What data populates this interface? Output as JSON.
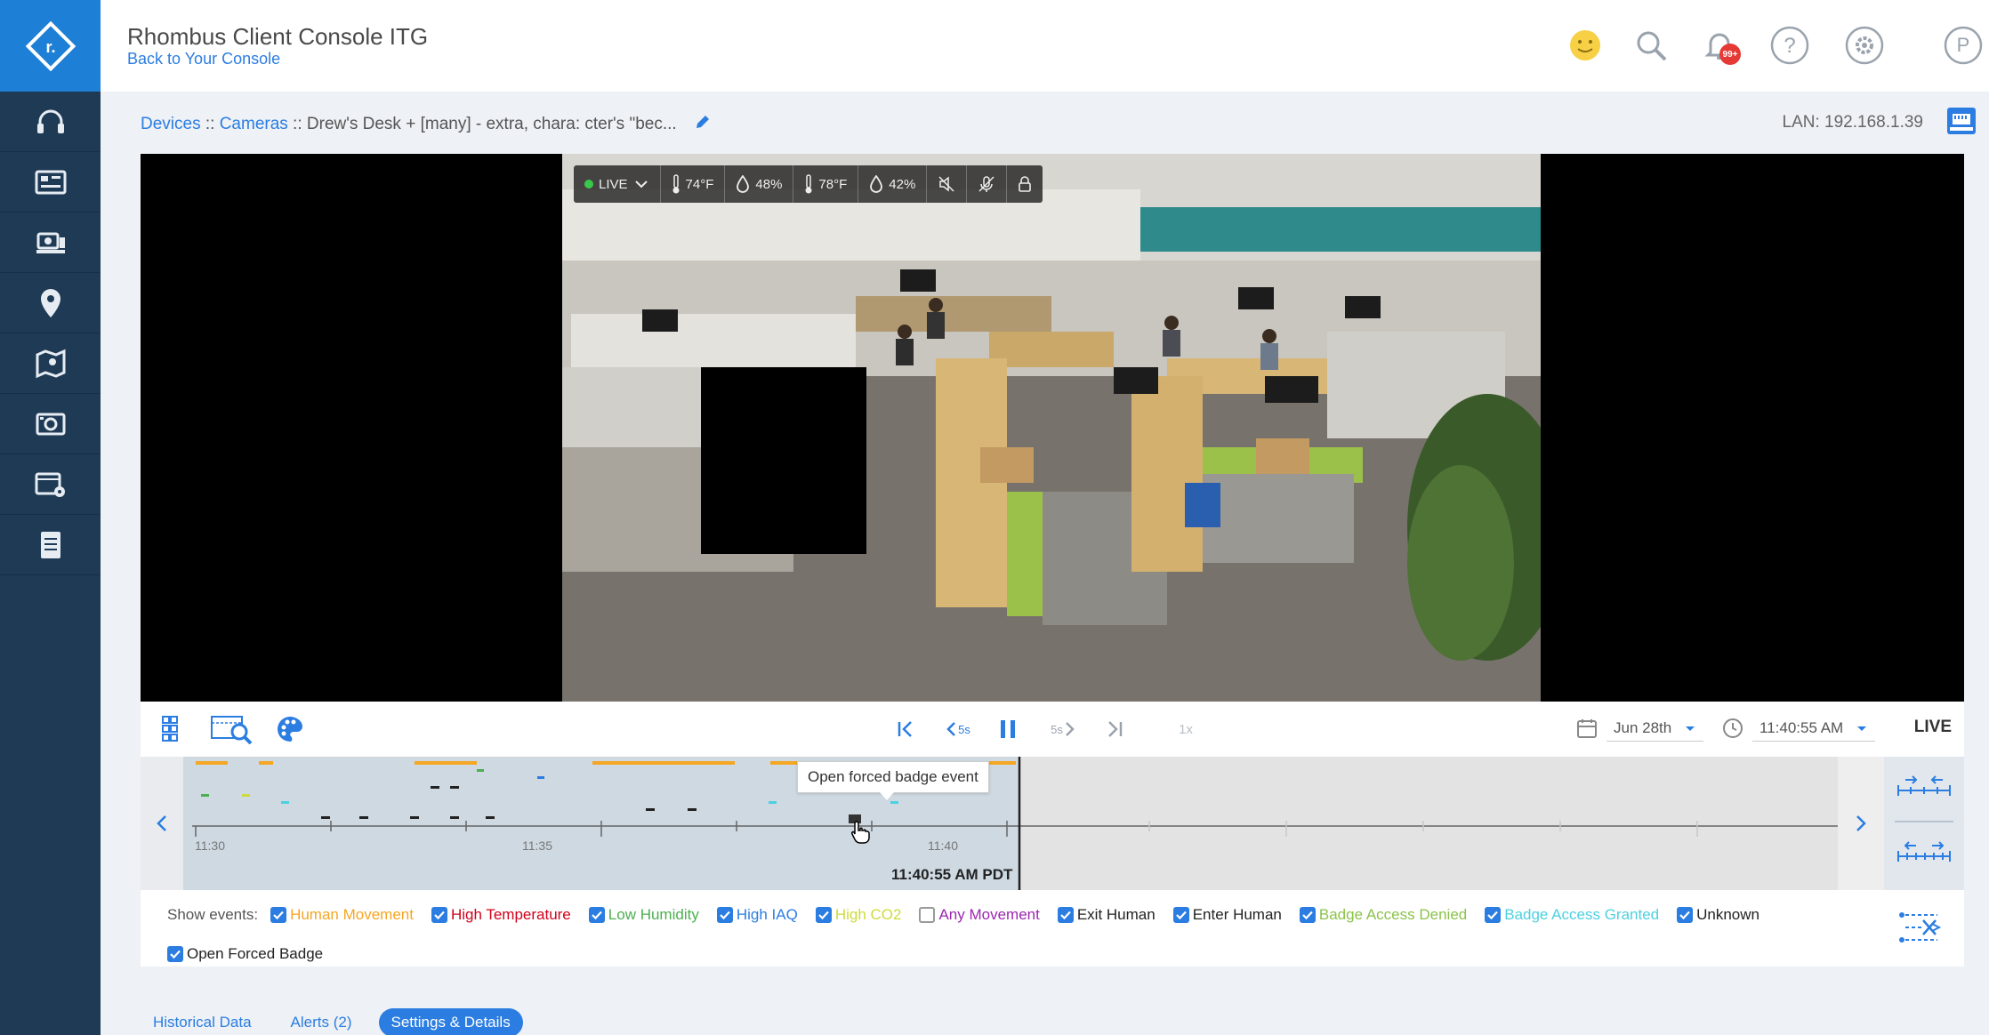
{
  "app": {
    "title": "Rhombus Client Console ITG",
    "back_link": "Back to Your Console",
    "notifications_badge": "99+",
    "user_initial": "P"
  },
  "sidebar": {
    "items": [
      {
        "name": "support-icon"
      },
      {
        "name": "dashboard-icon"
      },
      {
        "name": "devices-icon"
      },
      {
        "name": "location-pin-icon"
      },
      {
        "name": "floorplan-map-icon"
      },
      {
        "name": "camera-view-icon"
      },
      {
        "name": "video-settings-icon"
      },
      {
        "name": "document-icon"
      }
    ]
  },
  "breadcrumb": {
    "devices": "Devices",
    "sep1": " :: ",
    "cameras": "Cameras",
    "sep2": " :: ",
    "current": "Drew's Desk + [many] - extra, chara: cter's \"bec..."
  },
  "lan": "LAN: 192.168.1.39",
  "overlay": {
    "live": "LIVE",
    "temp1": "74°F",
    "humidity1": "48%",
    "temp2": "78°F",
    "humidity2": "42%"
  },
  "controls": {
    "skip_back": "5s",
    "skip_forward": "5s",
    "speed": "1x",
    "date": "Jun 28th",
    "time": "11:40:55 AM",
    "live": "LIVE"
  },
  "timeline": {
    "tooltip": "Open forced badge event",
    "current_time": "11:40:55 AM PDT",
    "ticks": [
      "11:30",
      "11:35",
      "11:40"
    ]
  },
  "events": {
    "label": "Show events:",
    "items": [
      {
        "label": "Human Movement",
        "checked": true,
        "color": "#f5a623"
      },
      {
        "label": "High Temperature",
        "checked": true,
        "color": "#d0021b"
      },
      {
        "label": "Low Humidity",
        "checked": true,
        "color": "#4caf50"
      },
      {
        "label": "High IAQ",
        "checked": true,
        "color": "#2b7de1"
      },
      {
        "label": "High CO2",
        "checked": true,
        "color": "#cddc39"
      },
      {
        "label": "Any Movement",
        "checked": false,
        "color": "#9c27b0"
      },
      {
        "label": "Exit Human",
        "checked": true,
        "color": "#222222"
      },
      {
        "label": "Enter Human",
        "checked": true,
        "color": "#222222"
      },
      {
        "label": "Badge Access Denied",
        "checked": true,
        "color": "#8bc34a"
      },
      {
        "label": "Badge Access Granted",
        "checked": true,
        "color": "#4dd0e1"
      },
      {
        "label": "Unknown",
        "checked": true,
        "color": "#222222"
      },
      {
        "label": "Open Forced Badge",
        "checked": true,
        "color": "#222222"
      }
    ]
  },
  "tabs": [
    {
      "label": "Historical Data",
      "active": false
    },
    {
      "label": "Alerts (2)",
      "active": false
    },
    {
      "label": "Settings & Details",
      "active": true
    }
  ]
}
